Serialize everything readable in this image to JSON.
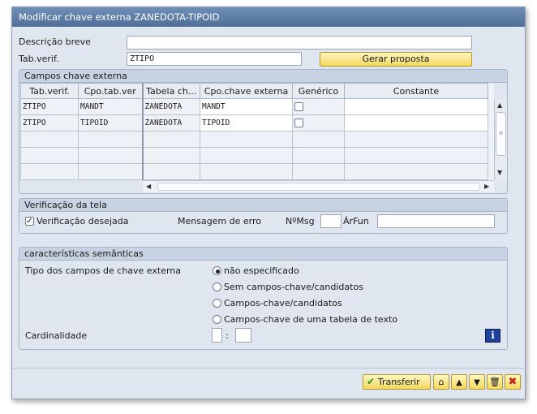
{
  "window": {
    "title": "Modificar chave externa ZANEDOTA-TIPOID"
  },
  "header": {
    "descricao_label": "Descrição breve",
    "descricao_value": "",
    "tabverif_label": "Tab.verif.",
    "tabverif_value": "ZTIPO",
    "gerar_button": "Gerar proposta"
  },
  "campos": {
    "title": "Campos chave externa",
    "columns": [
      "Tab.verif.",
      "Cpo.tab.ver",
      "Tabela ch...",
      "Cpo.chave externa",
      "Genérico",
      "Constante"
    ],
    "rows": [
      {
        "tab": "ZTIPO",
        "cpo": "MANDT",
        "tabela": "ZANEDOTA",
        "cpochave": "MANDT",
        "generico": false,
        "constante": ""
      },
      {
        "tab": "ZTIPO",
        "cpo": "TIPOID",
        "tabela": "ZANEDOTA",
        "cpochave": "TIPOID",
        "generico": false,
        "constante": ""
      }
    ]
  },
  "verificacao": {
    "title": "Verificação da tela",
    "checkbox_label": "Verificação desejada",
    "checked": true,
    "mensagem_label": "Mensagem de erro",
    "nmsg_label": "NºMsg",
    "nmsg_value": "",
    "arfun_label": "ÁrFun",
    "arfun_value": ""
  },
  "semanticas": {
    "title": "características semânticas",
    "tipo_label": "Tipo dos campos de chave externa",
    "options": [
      {
        "label": "não especificado",
        "selected": true
      },
      {
        "label": "Sem campos-chave/candidatos",
        "selected": false
      },
      {
        "label": "Campos-chave/candidatos",
        "selected": false
      },
      {
        "label": "Campos-chave de uma tabela de texto",
        "selected": false
      }
    ],
    "cardinalidade_label": "Cardinalidade",
    "card_left": "",
    "card_sep": ":",
    "card_right": ""
  },
  "footer": {
    "transferir_label": "Transferir",
    "icons": [
      "check-icon",
      "sub-table-icon",
      "up-arrow-icon",
      "down-arrow-icon",
      "trash-icon",
      "cancel-icon"
    ]
  },
  "colors": {
    "title_bar": "#5c7ca6",
    "button_yellow": "#f3d860",
    "cancel_red": "#c8241c",
    "check_green": "#2f8a1e"
  }
}
